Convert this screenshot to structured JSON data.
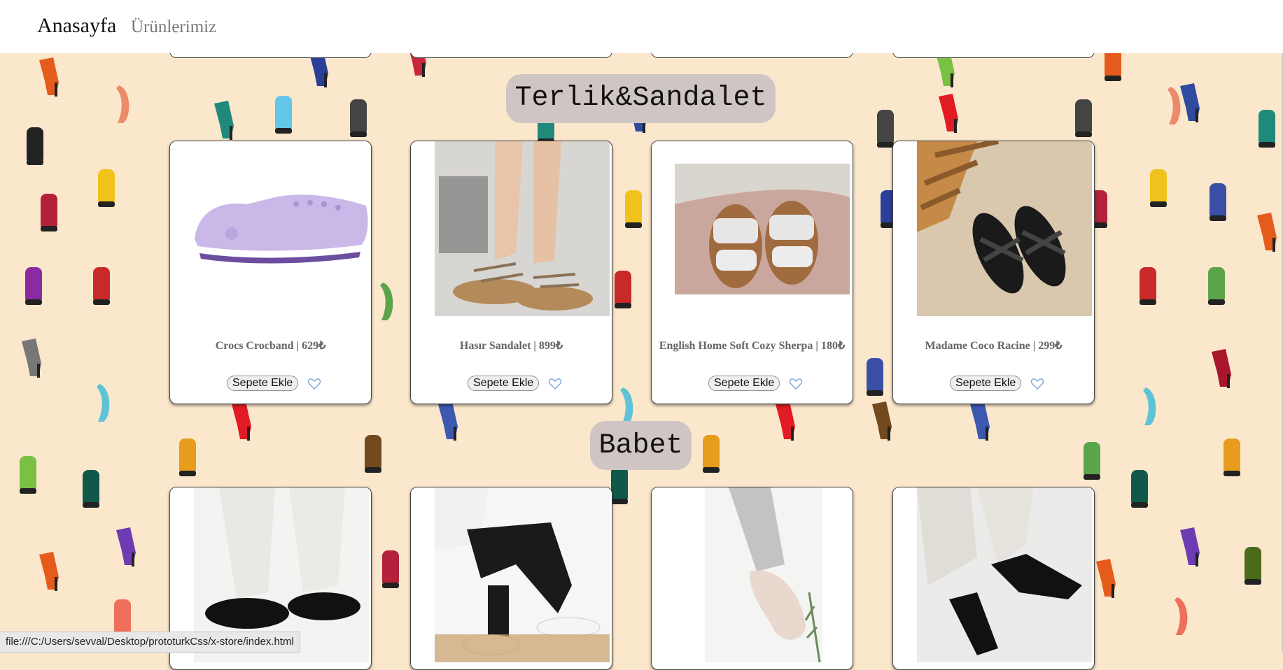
{
  "nav": {
    "brand": "Anasayfa",
    "products_link": "Ürünlerimiz"
  },
  "sections": [
    {
      "title": "Terlik&Sandalet",
      "products": [
        {
          "name": "Crocs Crocband | 629₺",
          "button": "Sepete Ekle",
          "image": "lilac-clog-image"
        },
        {
          "name": "Hasır Sandalet | 899₺",
          "button": "Sepete Ekle",
          "image": "straw-sandal-image"
        },
        {
          "name": "English Home Soft Cozy Sherpa | 180₺",
          "button": "Sepete Ekle",
          "image": "sherpa-slide-image"
        },
        {
          "name": "Madame Coco Racine | 299₺",
          "button": "Sepete Ekle",
          "image": "black-slide-image"
        }
      ]
    },
    {
      "title": "Babet",
      "products": [
        {
          "image": "black-ballet-flat-image"
        },
        {
          "image": "white-ankle-strap-flat-image"
        },
        {
          "image": "beige-loafer-flat-image"
        },
        {
          "image": "black-strap-flat-image"
        }
      ]
    }
  ],
  "status_bar": "file:///C:/Users/sevval/Desktop/prototurkCss/x-store/index.html",
  "icons": {
    "favorite": "heart-outline-icon"
  },
  "colors": {
    "background": "#fbe7cc",
    "title_pill": "#cfc6c4",
    "heart": "#7aa3d6"
  }
}
